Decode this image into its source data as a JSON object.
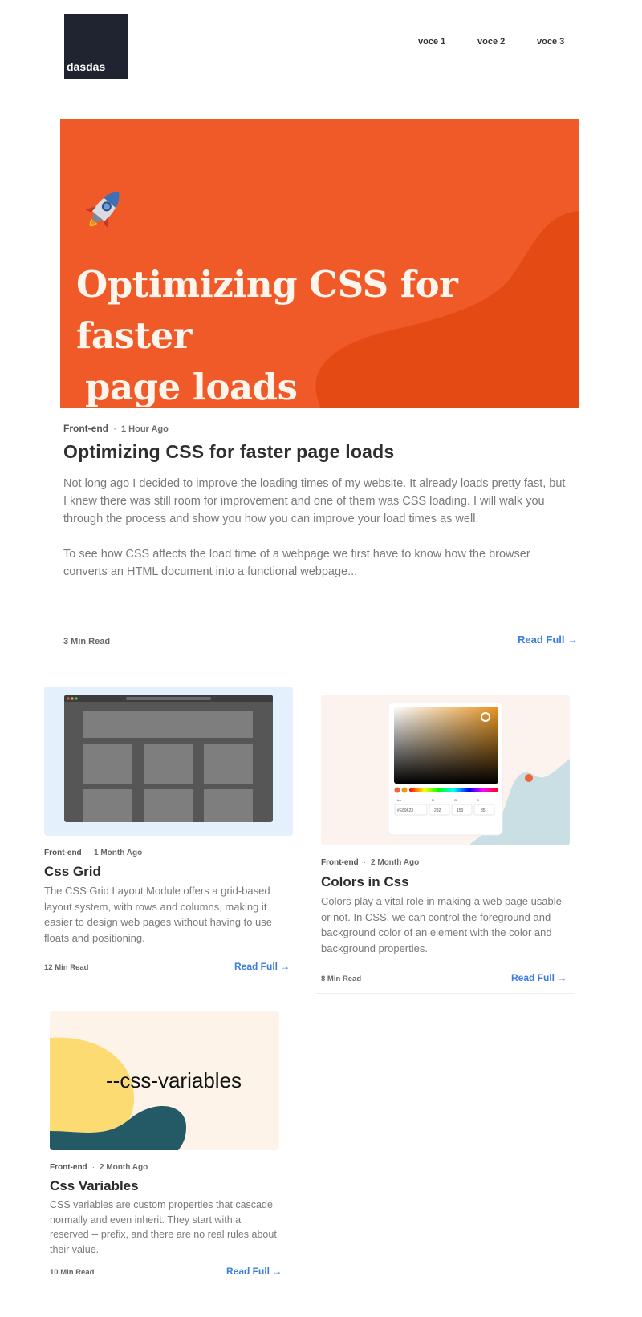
{
  "header": {
    "logo_text": "dasdas",
    "nav": [
      "voce 1",
      "voce 2",
      "voce 3"
    ]
  },
  "featured": {
    "image_title_line1": "Optimizing CSS for faster",
    "image_title_line2": "page loads",
    "category": "Front-end",
    "separator": "·",
    "time": "1 Hour Ago",
    "title": "Optimizing CSS for faster page loads",
    "excerpt_p1": "Not long ago I decided to improve the loading times of my website. It already loads pretty fast, but I knew there was still room for improvement and one of them was CSS loading. I will walk you through the process and show you how you can improve your load times as well.",
    "excerpt_p2": "To see how CSS affects the load time of a webpage we first have to know how the browser converts an HTML document into a functional webpage...",
    "read_time": "3 Min Read",
    "link": "Read Full →"
  },
  "cards": [
    {
      "category": "Front-end",
      "separator": "·",
      "time": "1 Month Ago",
      "title": "Css Grid",
      "excerpt": "The CSS Grid Layout Module offers a grid-based layout system, with rows and columns, making it easier to design web pages without having to use floats and positioning.",
      "read_time": "12 Min Read",
      "link": "Read Full →"
    },
    {
      "category": "Front-end",
      "separator": "·",
      "time": "2 Month Ago",
      "title": "Colors in Css",
      "excerpt": "Colors play a vital role in making a web page usable or not. In CSS, we can control the foreground and background color of an element with the color and background properties.",
      "read_time": "8 Min Read",
      "link": "Read Full →",
      "picker": {
        "hex_label": "Hex",
        "r_label": "R",
        "g_label": "G",
        "b_label": "B",
        "hex": "#E89623",
        "r": "232",
        "g": "150",
        "b": "35"
      }
    },
    {
      "category": "Front-end",
      "separator": "·",
      "time": "2 Month Ago",
      "title": "Css Variables",
      "excerpt": "CSS variables are custom properties that cascade normally and even inherit. They start with a reserved -- prefix, and there are no real rules about their value.",
      "read_time": "10 Min Read",
      "link": "Read Full →",
      "image_text": "--css-variables"
    }
  ],
  "colors": {
    "hero_bg": "#f05a28",
    "hero_wave": "#e44a14",
    "link": "#3b7de0",
    "logo_bg": "#1f2430"
  }
}
